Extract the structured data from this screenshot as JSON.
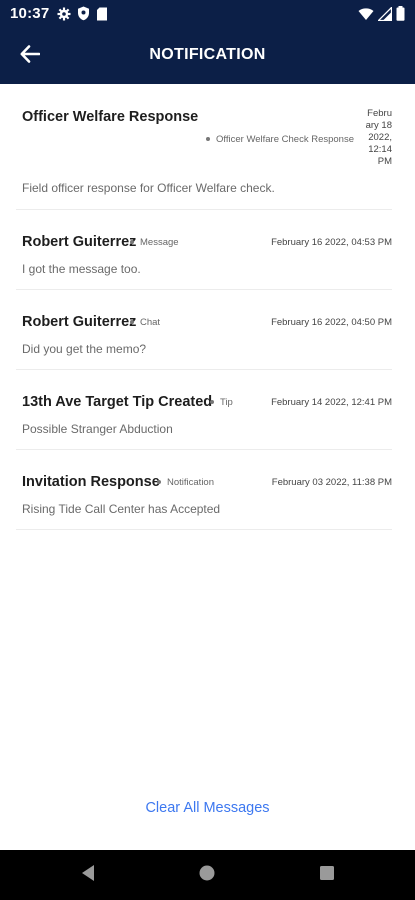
{
  "status_bar": {
    "time": "10:37",
    "icons_left": [
      "gear-icon",
      "shield-icon",
      "sd-card-icon"
    ],
    "icons_right": [
      "wifi-icon",
      "signal-icon",
      "battery-icon"
    ]
  },
  "header": {
    "title": "NOTIFICATION",
    "back_icon": "arrow-left-icon",
    "background": "#0c1f47"
  },
  "notifications": [
    {
      "title": "Officer Welfare Response",
      "type": "Officer Welfare Check Response",
      "date": "February 18 2022, 12:14 PM",
      "body": "Field officer response for Officer Welfare check."
    },
    {
      "title": "Robert Guiterrez",
      "type": "Message",
      "date": "February 16 2022, 04:53 PM",
      "body": "I got the message too."
    },
    {
      "title": "Robert Guiterrez",
      "type": "Chat",
      "date": "February 16 2022, 04:50 PM",
      "body": "Did you get the memo?"
    },
    {
      "title": "13th Ave Target Tip Created",
      "type": "Tip",
      "date": "February 14 2022, 12:41 PM",
      "body": "Possible Stranger Abduction"
    },
    {
      "title": "Invitation Response",
      "type": "Notification",
      "date": "February 03 2022, 11:38 PM",
      "body": "Rising Tide Call Center has Accepted"
    }
  ],
  "actions": {
    "clear_all": "Clear All Messages",
    "accent_color": "#3d78f0"
  },
  "nav_bar": {
    "icons": [
      "back-triangle-icon",
      "home-circle-icon",
      "recents-square-icon"
    ]
  }
}
